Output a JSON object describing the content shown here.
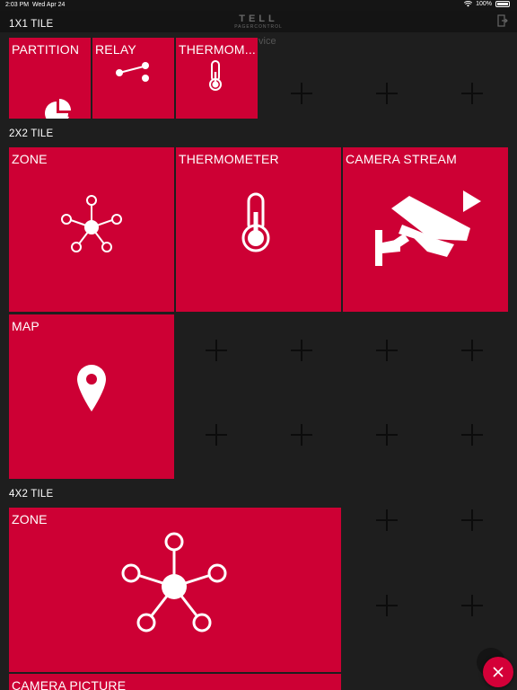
{
  "status_bar": {
    "time": "2:03 PM",
    "date": "Wed Apr 24",
    "battery": "100%"
  },
  "header": {
    "logo_top": "TELL",
    "logo_bottom": "PAGERCONTROL",
    "ghost_text": "vice"
  },
  "sections": {
    "tile_1x1": "1X1 TILE",
    "tile_2x2": "2X2 TILE",
    "tile_4x2": "4X2 TILE"
  },
  "tiles_1x1": [
    {
      "label": "PARTITION",
      "icon": "pie-chart-icon"
    },
    {
      "label": "RELAY",
      "icon": "relay-icon"
    },
    {
      "label": "THERMOM...",
      "icon": "thermometer-icon"
    }
  ],
  "tiles_2x2": [
    {
      "label": "ZONE",
      "icon": "zone-network-icon"
    },
    {
      "label": "THERMOMETER",
      "icon": "thermometer-icon"
    },
    {
      "label": "CAMERA STREAM",
      "icon": "security-camera-icon"
    },
    {
      "label": "MAP",
      "icon": "map-pin-icon"
    }
  ],
  "tiles_4x2": [
    {
      "label": "ZONE",
      "icon": "zone-network-icon"
    },
    {
      "label": "CAMERA PICTURE",
      "icon": "camera-icon"
    }
  ],
  "fab": {
    "icon": "close-icon"
  },
  "colors": {
    "tile": "#cd0034",
    "background": "#1e1e1e",
    "fab": "#d40038"
  }
}
